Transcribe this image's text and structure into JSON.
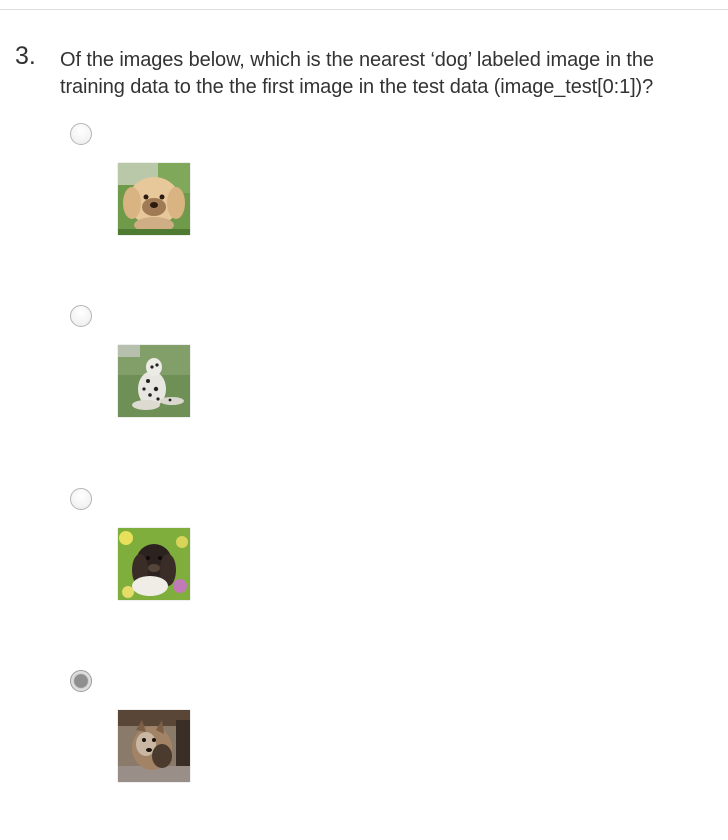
{
  "question": {
    "number": "3.",
    "text_line1": "Of the images below, which is the nearest ‘dog’ labeled image in the",
    "text_line2": "training data to the the first image in the test data (image_test[0:1])?"
  },
  "options": [
    {
      "selected": false,
      "image": "fluffy-tan-dog-on-grass-photo"
    },
    {
      "selected": false,
      "image": "dalmatian-lying-on-grass-photo"
    },
    {
      "selected": false,
      "image": "dark-spaniel-in-flowers-photo"
    },
    {
      "selected": true,
      "image": "small-terrier-dog-photo"
    }
  ]
}
